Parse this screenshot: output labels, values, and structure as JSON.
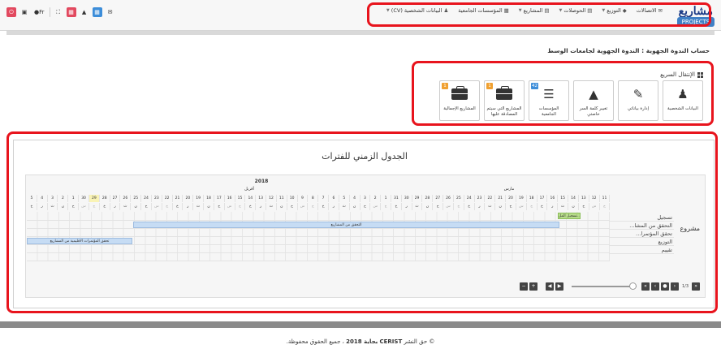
{
  "logo": {
    "title": "مشاريع",
    "subtitle": "PROJECTS"
  },
  "menu": [
    {
      "label": "البيانات الشخصية (CV)",
      "icon": "user-icon"
    },
    {
      "label": "المؤسسات الجامعية",
      "icon": "table-icon"
    },
    {
      "label": "المشاريع",
      "icon": "bank-icon"
    },
    {
      "label": "الحوصلات",
      "icon": "bank-icon"
    },
    {
      "label": "التوزيع",
      "icon": "tag-icon"
    },
    {
      "label": "الاتصالات",
      "icon": "chat-icon"
    }
  ],
  "tools": {
    "lang": "Fr"
  },
  "breadcrumb": "حساب الندوة الجهوية : الندوة الجهوية لجامعات الوسط",
  "quick": {
    "heading": "الإنتقال السريع",
    "tiles": [
      {
        "label": "البيانات الشخصية",
        "icon": "user-icon"
      },
      {
        "label": "إدارة بياناتي",
        "icon": "pencil-icon"
      },
      {
        "label": "تغيير كلمة السر خاصتي",
        "icon": "unlock-icon"
      },
      {
        "label": "المؤسسات الجامعية",
        "icon": "list-icon",
        "badge": "42",
        "badge_color": "#3c8dd9"
      },
      {
        "label": "المشاريع التي سيتم المصادقة عليها",
        "icon": "briefcase-icon",
        "badge": "1",
        "badge_color": "#f0a030"
      },
      {
        "label": "المشاريع الإجمالية",
        "icon": "briefcase-icon",
        "badge": "1",
        "badge_color": "#f0a030"
      }
    ]
  },
  "gantt": {
    "title": "الجدول الزمني للفترات",
    "year": "2018",
    "months": [
      "مارس",
      "أفريل"
    ],
    "days": [
      "11",
      "12",
      "13",
      "14",
      "15",
      "16",
      "17",
      "18",
      "19",
      "20",
      "21",
      "22",
      "23",
      "24",
      "25",
      "26",
      "27",
      "28",
      "29",
      "30",
      "31",
      "1",
      "2",
      "3",
      "4",
      "5",
      "6",
      "7",
      "8",
      "9",
      "10",
      "11",
      "12",
      "13",
      "14",
      "15",
      "16",
      "17",
      "18",
      "19",
      "20",
      "21",
      "22",
      "23",
      "24",
      "25",
      "26",
      "27",
      "28",
      "29",
      "30",
      "1",
      "2",
      "3",
      "4",
      "5"
    ],
    "daynames": [
      "ج",
      "س",
      "ح",
      "ن",
      "ث",
      "ر",
      "خ",
      "ج",
      "س",
      "ح",
      "ن",
      "ث",
      "ر",
      "خ",
      "ج",
      "س",
      "ح",
      "ن",
      "ث",
      "ر",
      "خ",
      "ج",
      "س",
      "ح",
      "ن",
      "ث",
      "ر",
      "خ",
      "ج",
      "س",
      "ح",
      "ن",
      "ث",
      "ر",
      "خ",
      "ج",
      "س",
      "ح",
      "ن",
      "ث",
      "ر",
      "خ",
      "ج",
      "س",
      "ح",
      "ن",
      "ث",
      "ر",
      "خ",
      "ج",
      "س",
      "ح",
      "ن",
      "ث",
      "ر",
      "خ"
    ],
    "project_label": "مشروع",
    "tasks": [
      "تسجيل",
      "التحقق من المشا...",
      "تحقق المؤتمرا...",
      "التوزيع",
      "تقييم"
    ],
    "bars": [
      {
        "label": "تسجيل المل...",
        "start_day": "13",
        "end_day": "14",
        "color": "green"
      },
      {
        "label": "التحقق من المشاريع",
        "start_day": "15",
        "end_day": "24",
        "color": "blue"
      },
      {
        "label": "تحقق المؤتمرات الاقليمية من المشاريع",
        "start_day": "26",
        "end_day": "4",
        "color": "blue"
      }
    ],
    "pager": "1/3"
  },
  "footer": {
    "copyright": "© حق النشر",
    "org": "CERIST",
    "place": "بجاية 2018",
    "rights": "، جميع الحقوق محفوظة."
  }
}
